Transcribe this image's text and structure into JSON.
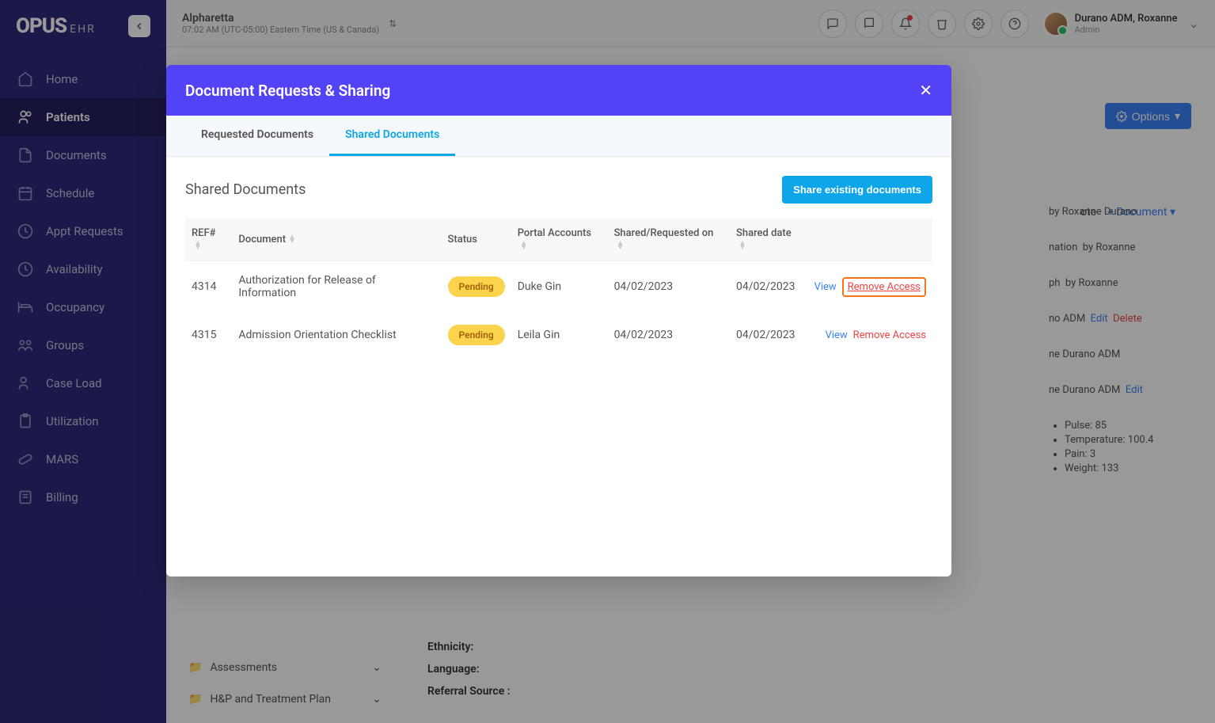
{
  "app": {
    "logo_main": "OPUS",
    "logo_sub": "EHR"
  },
  "location": {
    "name": "Alpharetta",
    "time": "07:02 AM (UTC-05:00) Eastern Time (US & Canada)"
  },
  "user": {
    "name": "Durano ADM, Roxanne",
    "role": "Admin"
  },
  "nav": {
    "home": "Home",
    "patients": "Patients",
    "documents": "Documents",
    "schedule": "Schedule",
    "appt": "Appt Requests",
    "availability": "Availability",
    "occupancy": "Occupancy",
    "groups": "Groups",
    "caseload": "Case Load",
    "utilization": "Utilization",
    "mars": "MARS",
    "billing": "Billing"
  },
  "options_btn": "Options",
  "bg": {
    "note": "ote",
    "document": "+ Document",
    "timeline1": "by   Roxanne Durano",
    "timeline2_a": "nation",
    "timeline2_b": "by   Roxanne",
    "timeline3_a": "ph",
    "timeline3_b": "by   Roxanne",
    "timeline4_a": "no ADM",
    "timeline4_edit": "Edit",
    "timeline4_delete": "Delete",
    "timeline5": "ne Durano ADM",
    "timeline6_a": "ne Durano ADM",
    "timeline6_edit": "Edit",
    "vitals": {
      "pulse": "Pulse: 85",
      "temp": "Temperature: 100.4",
      "pain": "Pain: 3",
      "weight": "Weight: 133"
    },
    "labels": {
      "ethnicity": "Ethnicity:",
      "language": "Language:",
      "referral": "Referral Source :"
    },
    "accordion": {
      "assessments": "Assessments",
      "hp": "H&P and Treatment Plan"
    }
  },
  "modal": {
    "title": "Document Requests & Sharing",
    "tab_requested": "Requested Documents",
    "tab_shared": "Shared Documents",
    "section_title": "Shared Documents",
    "share_btn": "Share existing documents",
    "columns": {
      "ref": "REF#",
      "document": "Document",
      "status": "Status",
      "portal": "Portal Accounts",
      "shared_on": "Shared/Requested on",
      "shared_date": "Shared date"
    },
    "rows": [
      {
        "ref": "4314",
        "document": "Authorization for Release of Information",
        "status": "Pending",
        "portal": "Duke Gin",
        "shared_on": "04/02/2023",
        "shared_date": "04/02/2023",
        "view": "View",
        "remove": "Remove Access",
        "highlight": true
      },
      {
        "ref": "4315",
        "document": "Admission Orientation Checklist",
        "status": "Pending",
        "portal": "Leila Gin",
        "shared_on": "04/02/2023",
        "shared_date": "04/02/2023",
        "view": "View",
        "remove": "Remove Access",
        "highlight": false
      }
    ]
  }
}
